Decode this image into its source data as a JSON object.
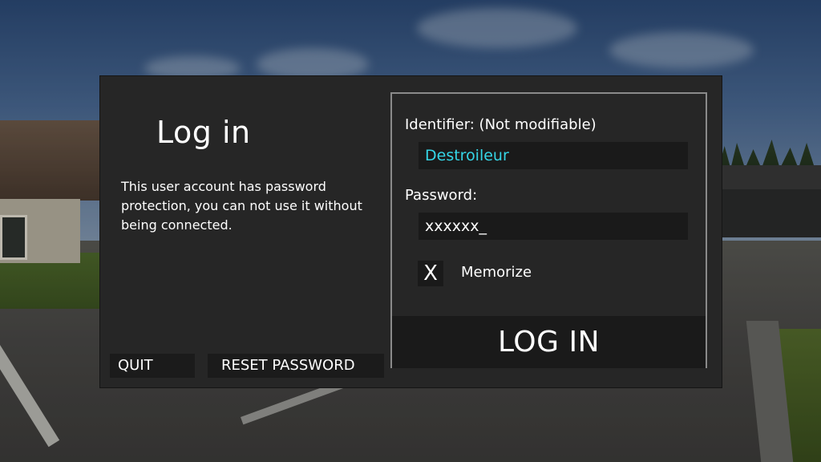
{
  "dialog": {
    "title": "Log in",
    "info": "This user account has password protection, you can not use it without being connected.",
    "quit_label": "QUIT",
    "reset_password_label": "RESET PASSWORD"
  },
  "login_panel": {
    "identifier_label": "Identifier: (Not modifiable)",
    "identifier_value": "Destroileur",
    "password_label": "Password:",
    "password_value": "xxxxxx_",
    "memorize_checked_mark": "X",
    "memorize_label": "Memorize",
    "login_button_label": "LOG IN"
  },
  "colors": {
    "identifier_text": "#35d5e6",
    "dialog_bg": "#262626",
    "field_bg": "#1a1a1a"
  }
}
